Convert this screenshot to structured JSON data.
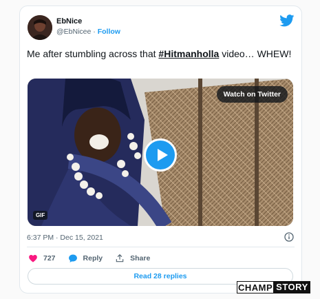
{
  "author": {
    "name": "EbNice",
    "handle": "@EbNicee",
    "separator": "·",
    "follow_label": "Follow"
  },
  "tweet": {
    "text_before": "Me after stumbling across that ",
    "hashtag": "#Hitmanholla",
    "text_after": " video… WHEW!"
  },
  "media": {
    "watch_label": "Watch on Twitter",
    "badge": "GIF"
  },
  "timestamp": "6:37 PM · Dec 15, 2021",
  "actions": {
    "likes": "727",
    "reply_label": "Reply",
    "share_label": "Share"
  },
  "replies_button": "Read 28 replies",
  "watermark": {
    "part1": "CHAMP",
    "part2": "STORY"
  },
  "colors": {
    "accent": "#1d9bf0",
    "like": "#f91880",
    "text": "#0f1419",
    "muted": "#536471"
  },
  "icons": [
    "twitter-bird-icon",
    "play-icon",
    "info-icon",
    "heart-icon",
    "reply-icon",
    "share-icon"
  ]
}
